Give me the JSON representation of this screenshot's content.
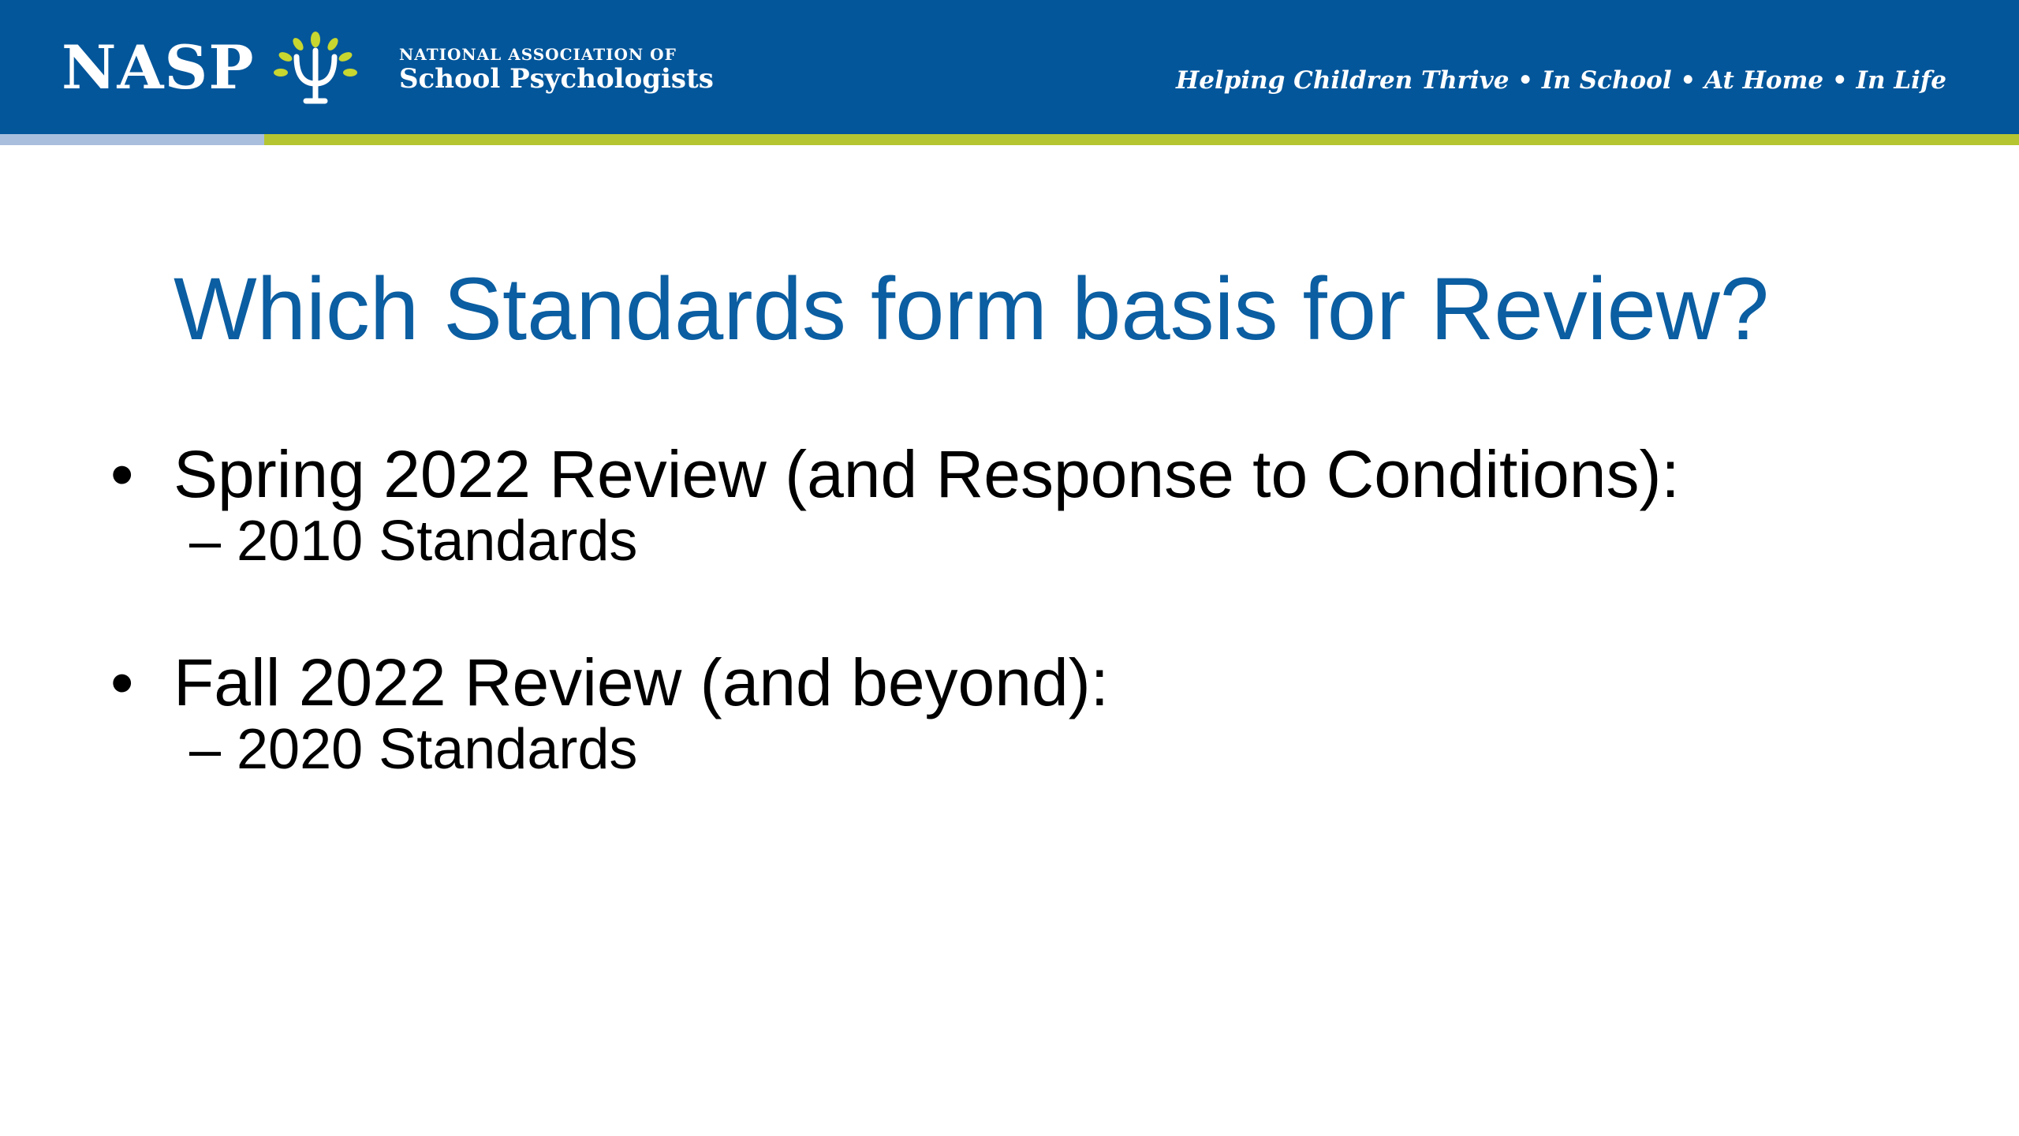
{
  "header": {
    "logo_text": "NASP",
    "org_line1": "NATIONAL ASSOCIATION OF",
    "org_line2": "School Psychologists",
    "tagline": "Helping Children Thrive  •  In School  •  At Home  •  In Life",
    "colors": {
      "band": "#04569a",
      "accent_rule": "#b5c531",
      "accent_rule_left": "#a9bedd",
      "psi_leaf": "#c8d630"
    }
  },
  "slide": {
    "title": "Which Standards form basis for Review?",
    "title_color": "#0b5ea1",
    "bullets": [
      {
        "marker": "•",
        "text": "Spring 2022 Review (and Response to Conditions):",
        "sub": [
          {
            "marker": "–",
            "text": "2010 Standards"
          }
        ]
      },
      {
        "marker": "•",
        "text": "Fall 2022 Review (and beyond):",
        "sub": [
          {
            "marker": "–",
            "text": "2020 Standards"
          }
        ]
      }
    ]
  }
}
